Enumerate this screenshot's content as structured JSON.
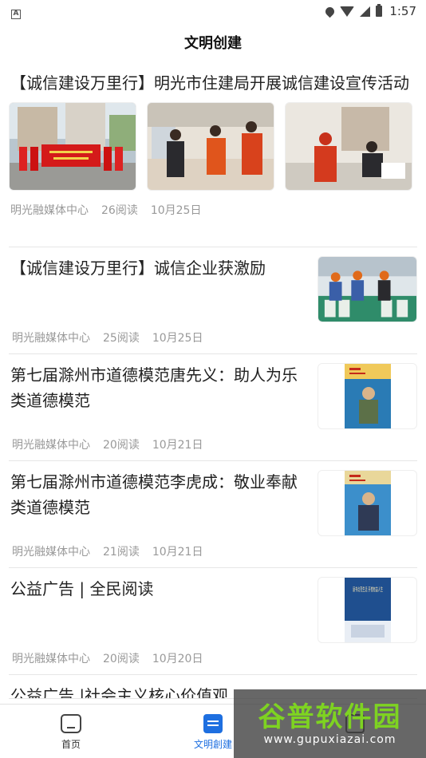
{
  "status_bar": {
    "time": "1:57",
    "left_icon": "A"
  },
  "page_title": "文明创建",
  "articles": [
    {
      "title": "【诚信建设万里行】明光市住建局开展诚信建设宣传活动",
      "source": "明光融媒体中心",
      "reads": "26阅读",
      "date": "10月25日",
      "images": [
        "group-photo-red-banner",
        "volunteers-at-counter",
        "volunteers-in-office"
      ]
    },
    {
      "title": "【诚信建设万里行】诚信企业获激励",
      "source": "明光融媒体中心",
      "reads": "25阅读",
      "date": "10月25日",
      "image": "factory-workers-photo"
    },
    {
      "title": "第七届滁州市道德模范唐先义：助人为乐类道德模范",
      "source": "明光融媒体中心",
      "reads": "20阅读",
      "date": "10月21日",
      "image": "moral-model-poster"
    },
    {
      "title": "第七届滁州市道德模范李虎成：敬业奉献类道德模范",
      "source": "明光融媒体中心",
      "reads": "21阅读",
      "date": "10月21日",
      "image": "moral-model-poster"
    },
    {
      "title": "公益广告 | 全民阅读",
      "source": "明光融媒体中心",
      "reads": "20阅读",
      "date": "10月20日",
      "image": "reading-poster",
      "poster_text": "读书点亮生活 开卷有益人生"
    },
    {
      "title": "公益广告 |社会主义核心价值观"
    }
  ],
  "bottom_nav": [
    {
      "label": "首页",
      "icon": "home-icon",
      "active": false
    },
    {
      "label": "文明創建",
      "icon": "news-icon",
      "active": true
    },
    {
      "label": "",
      "icon": "profile-icon",
      "active": false
    }
  ],
  "watermark": {
    "main": "谷普软件园",
    "url": "www.gupuxiazai.com"
  },
  "colors": {
    "accent": "#1e6fe0",
    "meta": "#999999",
    "divider": "#e6e6e6"
  }
}
